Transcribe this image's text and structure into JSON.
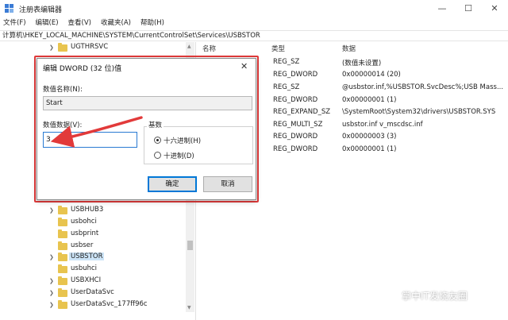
{
  "window": {
    "title": "注册表编辑器",
    "buttons": {
      "minimize": "—",
      "maximize": "☐",
      "close": "✕"
    }
  },
  "menu": [
    "文件(F)",
    "编辑(E)",
    "查看(V)",
    "收藏夹(A)",
    "帮助(H)"
  ],
  "address": "计算机\\HKEY_LOCAL_MACHINE\\SYSTEM\\CurrentControlSet\\Services\\USBSTOR",
  "tree": {
    "items": [
      {
        "label": "UGTHRSVC",
        "expandable": true
      },
      {
        "label": "USBHUB3",
        "expandable": true
      },
      {
        "label": "usbohci",
        "expandable": false
      },
      {
        "label": "usbprint",
        "expandable": false
      },
      {
        "label": "usbser",
        "expandable": false
      },
      {
        "label": "USBSTOR",
        "expandable": true,
        "selected": true
      },
      {
        "label": "usbuhci",
        "expandable": false
      },
      {
        "label": "USBXHCI",
        "expandable": true
      },
      {
        "label": "UserDataSvc",
        "expandable": true
      },
      {
        "label": "UserDataSvc_177ff96c",
        "expandable": true
      }
    ]
  },
  "values": {
    "headers": {
      "name": "名称",
      "type": "类型",
      "data": "数据"
    },
    "rows": [
      {
        "type": "REG_SZ",
        "data": "(数值未设置)"
      },
      {
        "type": "REG_DWORD",
        "data": "0x00000014 (20)"
      },
      {
        "type": "REG_SZ",
        "data": "@usbstor.inf,%USBSTOR.SvcDesc%;USB Mass..."
      },
      {
        "type": "REG_DWORD",
        "data": "0x00000001 (1)"
      },
      {
        "type": "REG_EXPAND_SZ",
        "data": "\\SystemRoot\\System32\\drivers\\USBSTOR.SYS"
      },
      {
        "type": "REG_MULTI_SZ",
        "data": "usbstor.inf v_mscdsc.inf"
      },
      {
        "type": "REG_DWORD",
        "data": "0x00000003 (3)"
      },
      {
        "type": "REG_DWORD",
        "data": "0x00000001 (1)"
      }
    ]
  },
  "dialog": {
    "title": "编辑 DWORD (32 位)值",
    "close": "✕",
    "name_label": "数值名称(N):",
    "name_value": "Start",
    "data_label": "数值数据(V):",
    "data_value": "3",
    "base_label": "基数",
    "radio_hex": "十六进制(H)",
    "radio_dec": "十进制(D)",
    "selected_base": "hex",
    "ok": "确定",
    "cancel": "取消",
    "highlight_color": "#e23a3a"
  },
  "watermark": "掌中IT发烧友圈"
}
